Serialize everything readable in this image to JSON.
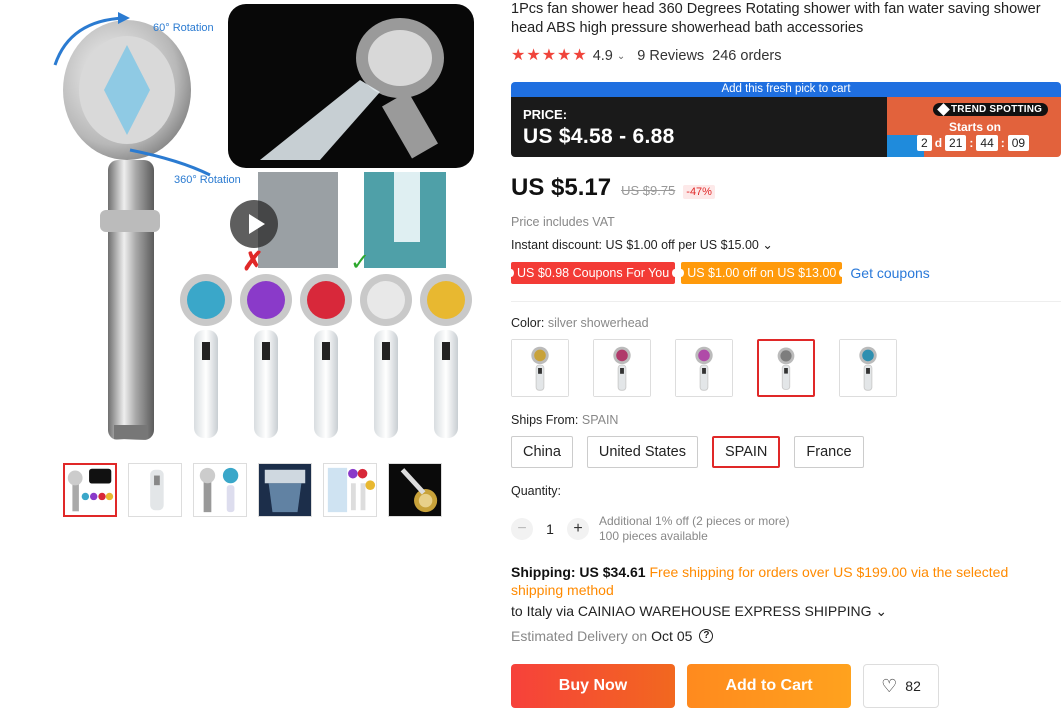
{
  "product": {
    "title": "1Pcs fan shower head 360 Degrees Rotating shower with fan water saving shower head ABS high pressure showerhead bath accessories",
    "rating": "4.9",
    "reviews": "9 Reviews",
    "orders": "246 orders"
  },
  "image_labels": {
    "rotation_60": "60° Rotation",
    "rotation_360": "360° Rotation"
  },
  "promo": {
    "strip": "Add this fresh pick to cart",
    "price_label": "PRICE:",
    "price_range": "US $4.58 - 6.88",
    "badge": "TREND SPOTTING",
    "starts_on": "Starts on",
    "days": "2",
    "days_unit": "d",
    "hours": "21",
    "minutes": "44",
    "seconds": "09"
  },
  "price": {
    "current": "US $5.17",
    "original": "US $9.75",
    "discount": "-47%",
    "vat": "Price includes VAT",
    "instant_discount": "Instant discount: US $1.00 off per US $15.00 ⌄"
  },
  "coupons": {
    "coupon1": "US $0.98 Coupons For You",
    "coupon2": "US $1.00 off on US $13.00",
    "get": "Get coupons"
  },
  "color": {
    "label": "Color:",
    "selected": "silver showerhead",
    "options": [
      "gold",
      "purple",
      "pink",
      "silver",
      "blue"
    ],
    "selected_index": 3,
    "swatch_colors": [
      "#c8a23a",
      "#b03a6a",
      "#b04aa8",
      "#7d7d7d",
      "#2e8fb0"
    ]
  },
  "ships_from": {
    "label": "Ships From:",
    "selected": "SPAIN",
    "options": [
      "China",
      "United States",
      "SPAIN",
      "France"
    ]
  },
  "quantity": {
    "label": "Quantity:",
    "value": "1",
    "minus": "−",
    "plus": "+",
    "additional": "Additional 1% off (2 pieces or more)",
    "available": "100 pieces available"
  },
  "shipping": {
    "cost": "Shipping: US $34.61",
    "free_note": "Free shipping for orders over US $199.00 via the selected shipping method",
    "to": "to Italy via CAINIAO WAREHOUSE EXPRESS SHIPPING ⌄",
    "est_label": "Estimated Delivery on",
    "est_date": "Oct 05",
    "help": "?"
  },
  "actions": {
    "buy_now": "Buy Now",
    "add_to_cart": "Add to Cart",
    "wishlist_count": "82"
  },
  "colors": {
    "accent_red": "#e02828",
    "coupon_orange": "#ff9a0b",
    "promo_blue": "#1f6fe0",
    "promo_orange": "#e2623c",
    "link_blue": "#2a79d9"
  }
}
